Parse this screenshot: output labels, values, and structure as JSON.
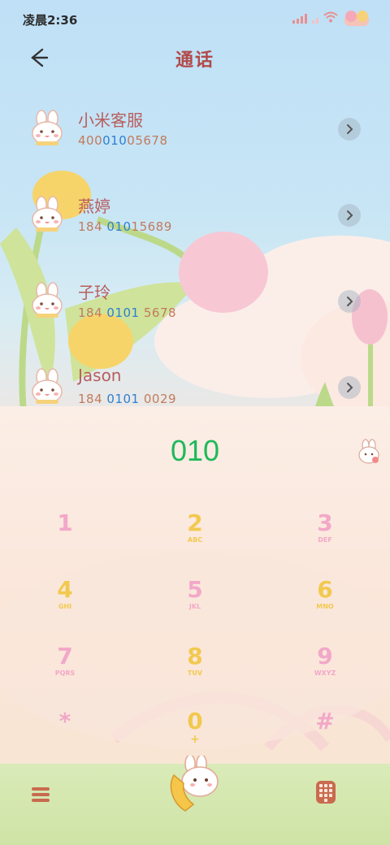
{
  "status": {
    "time": "凌晨2:36"
  },
  "header": {
    "title": "通话"
  },
  "contacts": [
    {
      "name": "小米客服",
      "num_pre": "400",
      "num_hl": "010",
      "num_post": "05678"
    },
    {
      "name": "燕婷",
      "num_pre": "184 ",
      "num_hl": "010",
      "num_post": "15689"
    },
    {
      "name": "子玲",
      "num_pre": "184 ",
      "num_hl": "0101",
      "num_post": " 5678"
    },
    {
      "name": "Jason",
      "num_pre": "184 ",
      "num_hl": "0101",
      "num_post": " 0029"
    }
  ],
  "dialer": {
    "number": "010",
    "keys": [
      {
        "digit": "1",
        "letters": ""
      },
      {
        "digit": "2",
        "letters": "ABC"
      },
      {
        "digit": "3",
        "letters": "DEF"
      },
      {
        "digit": "4",
        "letters": "GHI"
      },
      {
        "digit": "5",
        "letters": "JKL"
      },
      {
        "digit": "6",
        "letters": "MNO"
      },
      {
        "digit": "7",
        "letters": "PQRS"
      },
      {
        "digit": "8",
        "letters": "TUV"
      },
      {
        "digit": "9",
        "letters": "WXYZ"
      },
      {
        "digit": "*",
        "letters": ""
      },
      {
        "digit": "0",
        "letters": "+"
      },
      {
        "digit": "#",
        "letters": ""
      }
    ]
  },
  "icons": {
    "back": "back-arrow-icon",
    "chevron": "chevron-right-icon",
    "delete": "bunny-delete-icon",
    "menu": "menu-icon",
    "call": "bunny-phone-icon",
    "keypad": "keypad-icon"
  },
  "colors": {
    "title": "#b24a4a",
    "dial_number": "#1fb95a",
    "highlight": "#2e7fd1"
  }
}
